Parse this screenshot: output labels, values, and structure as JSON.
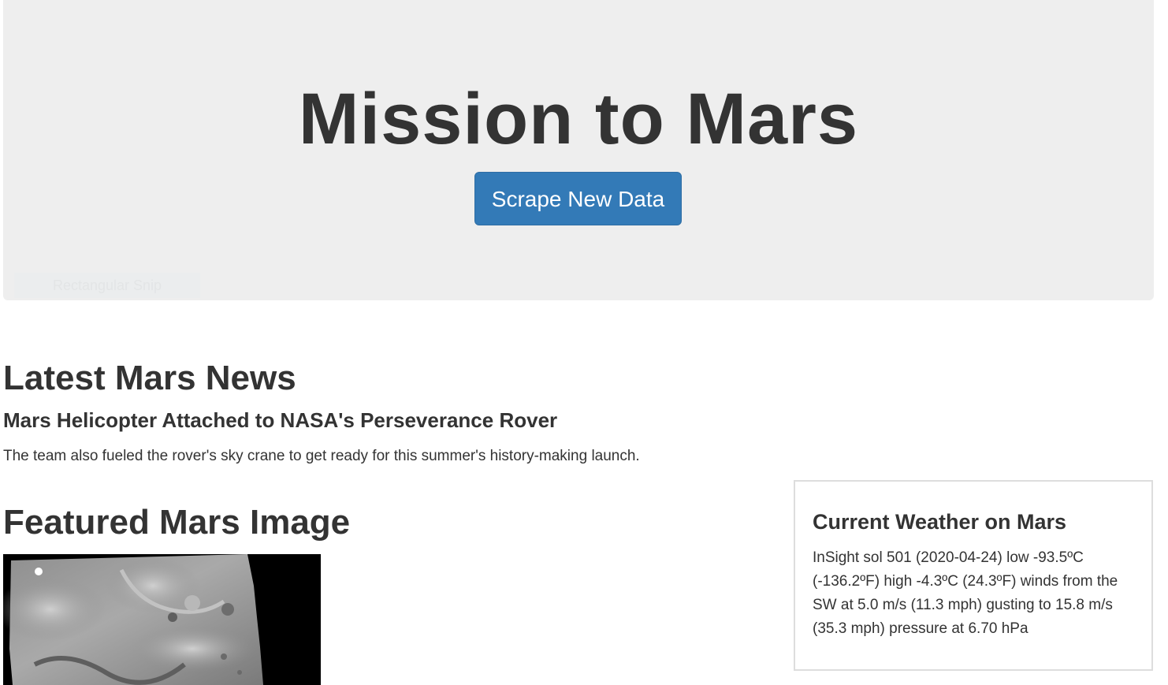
{
  "jumbotron": {
    "title": "Mission to Mars",
    "button_label": "Scrape New Data",
    "overlay_label": "Rectangular Snip"
  },
  "news": {
    "heading": "Latest Mars News",
    "title": "Mars Helicopter Attached to NASA's Perseverance Rover",
    "paragraph": "The team also fueled the rover's sky crane to get ready for this summer's history-making launch."
  },
  "featured": {
    "heading": "Featured Mars Image"
  },
  "weather": {
    "heading": "Current Weather on Mars",
    "report": "InSight sol 501 (2020-04-24) low -93.5ºC (-136.2ºF) high -4.3ºC (24.3ºF) winds from the SW at 5.0 m/s (11.3 mph) gusting to 15.8 m/s (35.3 mph) pressure at 6.70 hPa"
  },
  "colors": {
    "jumbotron_bg": "#eeeeee",
    "button_bg": "#337ab7",
    "text": "#333333"
  }
}
